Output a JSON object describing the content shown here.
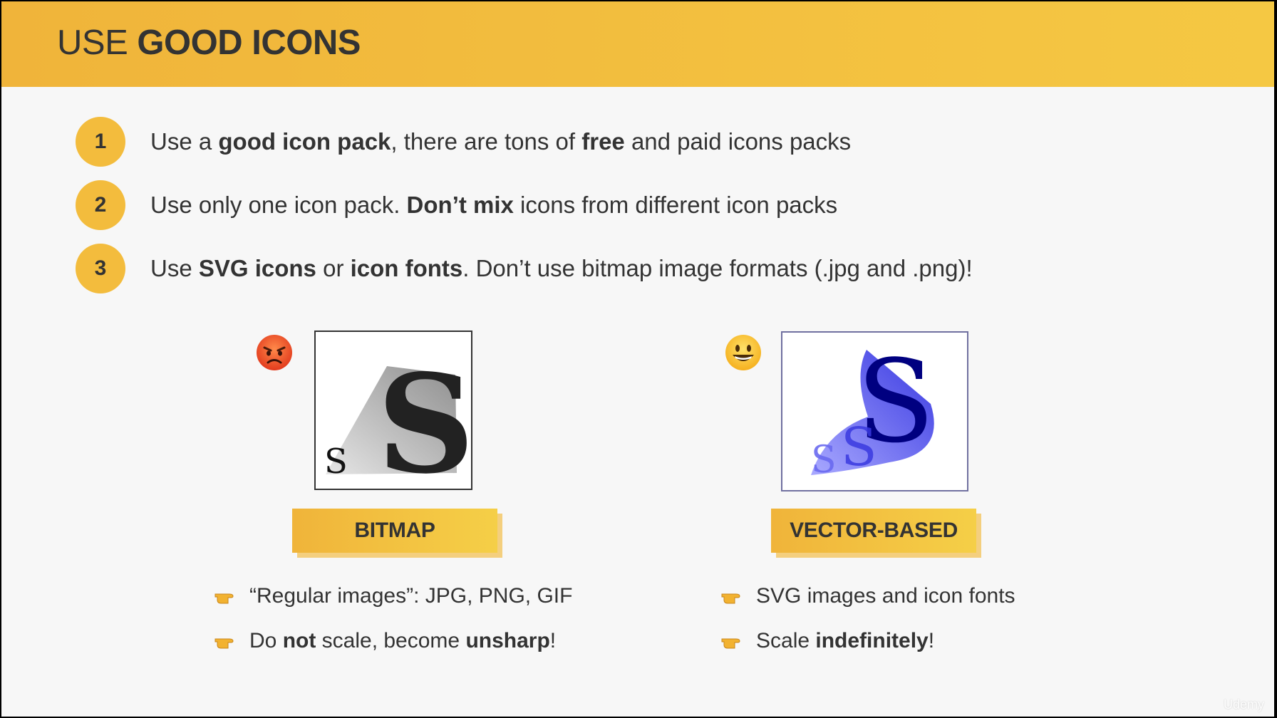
{
  "header": {
    "title_light": "USE ",
    "title_bold": "GOOD ICONS"
  },
  "points": [
    {
      "number": "1",
      "parts": [
        "Use a ",
        "good icon pack",
        ", there are tons of ",
        "free",
        " and paid icons packs"
      ]
    },
    {
      "number": "2",
      "parts": [
        "Use only one icon pack. ",
        "Don’t mix",
        " icons from different icon packs"
      ]
    },
    {
      "number": "3",
      "parts": [
        "Use ",
        "SVG icons",
        " or ",
        "icon fonts",
        ". Don’t use bitmap image formats (.jpg and .png)!"
      ]
    }
  ],
  "bitmap": {
    "emoji": "angry-face-emoji",
    "image_letters": {
      "small": "S",
      "large": "S"
    },
    "label": "BITMAP",
    "bullets": [
      {
        "parts": [
          "“Regular images”: JPG, PNG, GIF"
        ]
      },
      {
        "parts": [
          "Do ",
          "not",
          " scale, become ",
          "unsharp",
          "!"
        ]
      }
    ]
  },
  "vector": {
    "emoji": "smiling-face-emoji",
    "image_letters": {
      "small": "S",
      "medium": "S",
      "large": "S"
    },
    "label": "VECTOR-BASED",
    "bullets": [
      {
        "parts": [
          "SVG images and icon fonts"
        ]
      },
      {
        "parts": [
          "Scale ",
          "indefinitely",
          "!"
        ]
      }
    ]
  },
  "watermark": "Udemy",
  "colors": {
    "accent": "#f3bc3d",
    "text": "#333333",
    "vector_blue": "#1a1aa8"
  }
}
